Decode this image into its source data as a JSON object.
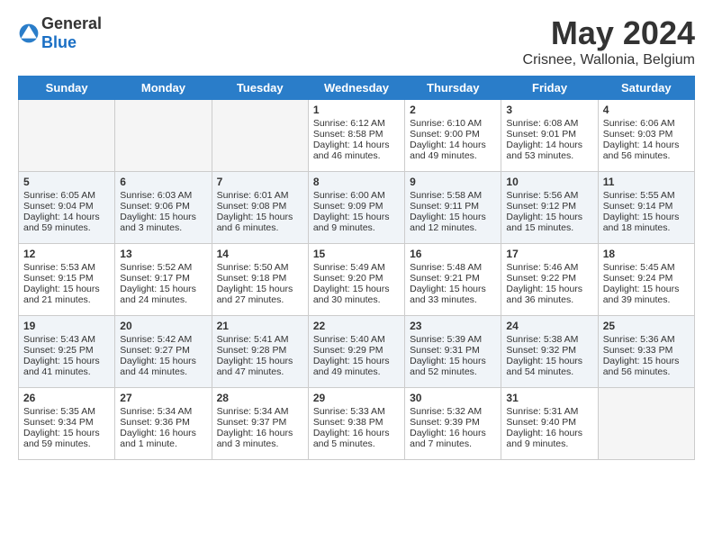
{
  "header": {
    "logo_general": "General",
    "logo_blue": "Blue",
    "title": "May 2024",
    "subtitle": "Crisnee, Wallonia, Belgium"
  },
  "days_of_week": [
    "Sunday",
    "Monday",
    "Tuesday",
    "Wednesday",
    "Thursday",
    "Friday",
    "Saturday"
  ],
  "weeks": [
    {
      "shade": "white",
      "days": [
        {
          "num": "",
          "empty": true
        },
        {
          "num": "",
          "empty": true
        },
        {
          "num": "",
          "empty": true
        },
        {
          "num": "1",
          "line1": "Sunrise: 6:12 AM",
          "line2": "Sunset: 8:58 PM",
          "line3": "Daylight: 14 hours",
          "line4": "and 46 minutes."
        },
        {
          "num": "2",
          "line1": "Sunrise: 6:10 AM",
          "line2": "Sunset: 9:00 PM",
          "line3": "Daylight: 14 hours",
          "line4": "and 49 minutes."
        },
        {
          "num": "3",
          "line1": "Sunrise: 6:08 AM",
          "line2": "Sunset: 9:01 PM",
          "line3": "Daylight: 14 hours",
          "line4": "and 53 minutes."
        },
        {
          "num": "4",
          "line1": "Sunrise: 6:06 AM",
          "line2": "Sunset: 9:03 PM",
          "line3": "Daylight: 14 hours",
          "line4": "and 56 minutes."
        }
      ]
    },
    {
      "shade": "shaded",
      "days": [
        {
          "num": "5",
          "line1": "Sunrise: 6:05 AM",
          "line2": "Sunset: 9:04 PM",
          "line3": "Daylight: 14 hours",
          "line4": "and 59 minutes."
        },
        {
          "num": "6",
          "line1": "Sunrise: 6:03 AM",
          "line2": "Sunset: 9:06 PM",
          "line3": "Daylight: 15 hours",
          "line4": "and 3 minutes."
        },
        {
          "num": "7",
          "line1": "Sunrise: 6:01 AM",
          "line2": "Sunset: 9:08 PM",
          "line3": "Daylight: 15 hours",
          "line4": "and 6 minutes."
        },
        {
          "num": "8",
          "line1": "Sunrise: 6:00 AM",
          "line2": "Sunset: 9:09 PM",
          "line3": "Daylight: 15 hours",
          "line4": "and 9 minutes."
        },
        {
          "num": "9",
          "line1": "Sunrise: 5:58 AM",
          "line2": "Sunset: 9:11 PM",
          "line3": "Daylight: 15 hours",
          "line4": "and 12 minutes."
        },
        {
          "num": "10",
          "line1": "Sunrise: 5:56 AM",
          "line2": "Sunset: 9:12 PM",
          "line3": "Daylight: 15 hours",
          "line4": "and 15 minutes."
        },
        {
          "num": "11",
          "line1": "Sunrise: 5:55 AM",
          "line2": "Sunset: 9:14 PM",
          "line3": "Daylight: 15 hours",
          "line4": "and 18 minutes."
        }
      ]
    },
    {
      "shade": "white",
      "days": [
        {
          "num": "12",
          "line1": "Sunrise: 5:53 AM",
          "line2": "Sunset: 9:15 PM",
          "line3": "Daylight: 15 hours",
          "line4": "and 21 minutes."
        },
        {
          "num": "13",
          "line1": "Sunrise: 5:52 AM",
          "line2": "Sunset: 9:17 PM",
          "line3": "Daylight: 15 hours",
          "line4": "and 24 minutes."
        },
        {
          "num": "14",
          "line1": "Sunrise: 5:50 AM",
          "line2": "Sunset: 9:18 PM",
          "line3": "Daylight: 15 hours",
          "line4": "and 27 minutes."
        },
        {
          "num": "15",
          "line1": "Sunrise: 5:49 AM",
          "line2": "Sunset: 9:20 PM",
          "line3": "Daylight: 15 hours",
          "line4": "and 30 minutes."
        },
        {
          "num": "16",
          "line1": "Sunrise: 5:48 AM",
          "line2": "Sunset: 9:21 PM",
          "line3": "Daylight: 15 hours",
          "line4": "and 33 minutes."
        },
        {
          "num": "17",
          "line1": "Sunrise: 5:46 AM",
          "line2": "Sunset: 9:22 PM",
          "line3": "Daylight: 15 hours",
          "line4": "and 36 minutes."
        },
        {
          "num": "18",
          "line1": "Sunrise: 5:45 AM",
          "line2": "Sunset: 9:24 PM",
          "line3": "Daylight: 15 hours",
          "line4": "and 39 minutes."
        }
      ]
    },
    {
      "shade": "shaded",
      "days": [
        {
          "num": "19",
          "line1": "Sunrise: 5:43 AM",
          "line2": "Sunset: 9:25 PM",
          "line3": "Daylight: 15 hours",
          "line4": "and 41 minutes."
        },
        {
          "num": "20",
          "line1": "Sunrise: 5:42 AM",
          "line2": "Sunset: 9:27 PM",
          "line3": "Daylight: 15 hours",
          "line4": "and 44 minutes."
        },
        {
          "num": "21",
          "line1": "Sunrise: 5:41 AM",
          "line2": "Sunset: 9:28 PM",
          "line3": "Daylight: 15 hours",
          "line4": "and 47 minutes."
        },
        {
          "num": "22",
          "line1": "Sunrise: 5:40 AM",
          "line2": "Sunset: 9:29 PM",
          "line3": "Daylight: 15 hours",
          "line4": "and 49 minutes."
        },
        {
          "num": "23",
          "line1": "Sunrise: 5:39 AM",
          "line2": "Sunset: 9:31 PM",
          "line3": "Daylight: 15 hours",
          "line4": "and 52 minutes."
        },
        {
          "num": "24",
          "line1": "Sunrise: 5:38 AM",
          "line2": "Sunset: 9:32 PM",
          "line3": "Daylight: 15 hours",
          "line4": "and 54 minutes."
        },
        {
          "num": "25",
          "line1": "Sunrise: 5:36 AM",
          "line2": "Sunset: 9:33 PM",
          "line3": "Daylight: 15 hours",
          "line4": "and 56 minutes."
        }
      ]
    },
    {
      "shade": "white",
      "days": [
        {
          "num": "26",
          "line1": "Sunrise: 5:35 AM",
          "line2": "Sunset: 9:34 PM",
          "line3": "Daylight: 15 hours",
          "line4": "and 59 minutes."
        },
        {
          "num": "27",
          "line1": "Sunrise: 5:34 AM",
          "line2": "Sunset: 9:36 PM",
          "line3": "Daylight: 16 hours",
          "line4": "and 1 minute."
        },
        {
          "num": "28",
          "line1": "Sunrise: 5:34 AM",
          "line2": "Sunset: 9:37 PM",
          "line3": "Daylight: 16 hours",
          "line4": "and 3 minutes."
        },
        {
          "num": "29",
          "line1": "Sunrise: 5:33 AM",
          "line2": "Sunset: 9:38 PM",
          "line3": "Daylight: 16 hours",
          "line4": "and 5 minutes."
        },
        {
          "num": "30",
          "line1": "Sunrise: 5:32 AM",
          "line2": "Sunset: 9:39 PM",
          "line3": "Daylight: 16 hours",
          "line4": "and 7 minutes."
        },
        {
          "num": "31",
          "line1": "Sunrise: 5:31 AM",
          "line2": "Sunset: 9:40 PM",
          "line3": "Daylight: 16 hours",
          "line4": "and 9 minutes."
        },
        {
          "num": "",
          "empty": true
        }
      ]
    }
  ]
}
